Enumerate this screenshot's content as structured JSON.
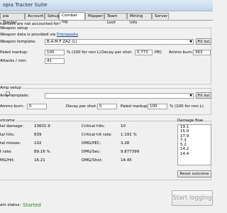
{
  "window": {
    "title": "opia Tracker Suite"
  },
  "tabs": [
    "pia Tracker",
    "Account",
    "Setup",
    "Combat log",
    "Mapper",
    "Team Loot",
    "Mining info",
    "Server"
  ],
  "active_tab": "Combat log",
  "notice": "hancers are not accounted for!",
  "weapon": {
    "group_label": "Weapon setup",
    "provided_by": "Weapon data is provided via",
    "provider_link": "Entropedia",
    "template_label": "Weapon template:",
    "template_value": "B.A.M.F ZA2 (L)",
    "fill_list": "Fill list",
    "paid_markup_label": "Paied markup:",
    "paid_markup": "100",
    "pct_note": "% (100 for non L)",
    "decay_label": "Decay per shot:",
    "decay": "0.773",
    "pec": "PEC",
    "ammo_label": "Ammo burn:",
    "ammo": "363",
    "attacks_label": "Attacks / min:",
    "attacks": "41"
  },
  "amp": {
    "group_label": "Amp setup",
    "template_label": "Amp template:",
    "template_value": "",
    "fill_list": "Fill list",
    "ammo_label": "Ammo burn:",
    "ammo": "0",
    "decay_label": "Decay per shot:",
    "decay": "0",
    "paid_markup_label": "Paied markup:",
    "paid_markup": "100",
    "pct_note": "% (100 for non L)"
  },
  "outcome": {
    "group_label": "utcome",
    "left": [
      {
        "label": "tal damage:",
        "value": "13601.9"
      },
      {
        "label": "tal hits:",
        "value": "839"
      },
      {
        "label": "tal misses:",
        "value": "102"
      },
      {
        "label": "t rate:",
        "value": "89.16 %"
      },
      {
        "label": "MG/Hit:",
        "value": "16.21"
      }
    ],
    "right": [
      {
        "label": "Critical hits:",
        "value": "10"
      },
      {
        "label": "Critical hit rate:",
        "value": "1.191 %"
      },
      {
        "label": "DMG/PEC:",
        "value": "3.28"
      },
      {
        "label": "DMG/Sec:",
        "value": "9.877399"
      },
      {
        "label": "DMG/Shot:",
        "value": "14.45"
      }
    ],
    "reset": "Reset outcome"
  },
  "damage_flow": {
    "label": "Damage flow",
    "values": [
      "19.1",
      "15.9",
      "17.9",
      "7.3",
      "5.2",
      "14.2",
      "14.4"
    ]
  },
  "footer": {
    "status_label": "am status:",
    "status_value": "Started",
    "start_button": "Start logging"
  },
  "colors": {
    "started": "#1e8c1e"
  }
}
